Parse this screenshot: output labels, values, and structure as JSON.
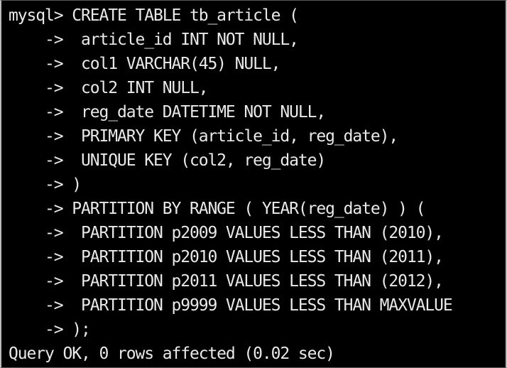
{
  "terminal": {
    "colors": {
      "background": "#000000",
      "text": "#e9e9e9",
      "frame": "#bdbdbd"
    },
    "lines": [
      "mysql> CREATE TABLE tb_article (",
      "    ->  article_id INT NOT NULL,",
      "    ->  col1 VARCHAR(45) NULL,",
      "    ->  col2 INT NULL,",
      "    ->  reg_date DATETIME NOT NULL,",
      "    ->  PRIMARY KEY (article_id, reg_date),",
      "    ->  UNIQUE KEY (col2, reg_date)",
      "    -> )",
      "    -> PARTITION BY RANGE ( YEAR(reg_date) ) (",
      "    ->  PARTITION p2009 VALUES LESS THAN (2010),",
      "    ->  PARTITION p2010 VALUES LESS THAN (2011),",
      "    ->  PARTITION p2011 VALUES LESS THAN (2012),",
      "    ->  PARTITION p9999 VALUES LESS THAN MAXVALUE",
      "    -> );",
      "Query OK, 0 rows affected (0.02 sec)"
    ]
  }
}
